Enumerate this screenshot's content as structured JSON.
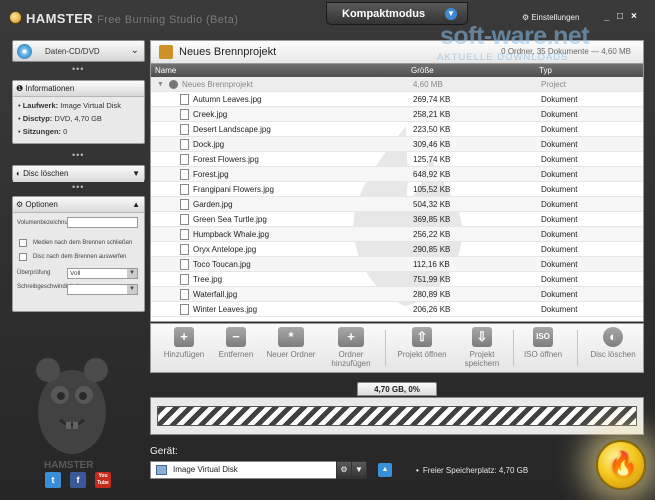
{
  "app": {
    "title": "HAMSTER",
    "subtitle": "Free Burning Studio (Beta)",
    "mode_label": "Kompaktmodus",
    "settings_label": "Einstellungen",
    "window_controls": [
      "_",
      "□",
      "×"
    ]
  },
  "sidebar": {
    "disc_type": "Daten-CD/DVD",
    "info": {
      "title": "Informationen",
      "drive_label": "Laufwerk:",
      "drive_value": "Image Virtual Disk",
      "disctype_label": "Disctyp:",
      "disctype_value": "DVD, 4,70 GB",
      "sessions_label": "Sitzungen:",
      "sessions_value": "0"
    },
    "erase_label": "Disc löschen",
    "options": {
      "title": "Optionen",
      "volume_label": "Volumenbezeichnung",
      "volume_value": "",
      "check_close_label": "Medien nach dem Brennen schließen",
      "check_eject_label": "Disc nach dem Brennen auswerfen",
      "verify_label": "Überprüfung",
      "verify_value": "Voll",
      "speed_label": "Schreibgeschwindigkeit",
      "speed_value": ""
    },
    "mascot_label": "HAMSTER",
    "social": [
      "t",
      "f",
      "You Tube"
    ]
  },
  "project": {
    "title": "Neues Brennprojekt",
    "summary": "0 Ordner, 35 Dokumente — 4,60 MB",
    "watermark": "soft-ware.net",
    "watermark_sub": "AKTUELLE DOWNLOADS"
  },
  "table": {
    "headers": [
      "Name",
      "Größe",
      "Typ"
    ],
    "root": {
      "name": "Neues Brennprojekt",
      "size": "4,60 MB",
      "type": "Project"
    },
    "rows": [
      {
        "name": "Autumn Leaves.jpg",
        "size": "269,74 KB",
        "type": "Dokument"
      },
      {
        "name": "Creek.jpg",
        "size": "258,21 KB",
        "type": "Dokument"
      },
      {
        "name": "Desert Landscape.jpg",
        "size": "223,50 KB",
        "type": "Dokument"
      },
      {
        "name": "Dock.jpg",
        "size": "309,46 KB",
        "type": "Dokument"
      },
      {
        "name": "Forest Flowers.jpg",
        "size": "125,74 KB",
        "type": "Dokument"
      },
      {
        "name": "Forest.jpg",
        "size": "648,92 KB",
        "type": "Dokument"
      },
      {
        "name": "Frangipani Flowers.jpg",
        "size": "105,52 KB",
        "type": "Dokument"
      },
      {
        "name": "Garden.jpg",
        "size": "504,32 KB",
        "type": "Dokument"
      },
      {
        "name": "Green Sea Turtle.jpg",
        "size": "369,85 KB",
        "type": "Dokument"
      },
      {
        "name": "Humpback Whale.jpg",
        "size": "256,22 KB",
        "type": "Dokument"
      },
      {
        "name": "Oryx Antelope.jpg",
        "size": "290,85 KB",
        "type": "Dokument"
      },
      {
        "name": "Toco Toucan.jpg",
        "size": "112,16 KB",
        "type": "Dokument"
      },
      {
        "name": "Tree.jpg",
        "size": "751,99 KB",
        "type": "Dokument"
      },
      {
        "name": "Waterfall.jpg",
        "size": "280,89 KB",
        "type": "Dokument"
      },
      {
        "name": "Winter Leaves.jpg",
        "size": "206,26 KB",
        "type": "Dokument"
      }
    ]
  },
  "toolbar": {
    "add": "Hinzufügen",
    "remove": "Entfernen",
    "new_folder": "Neuer Ordner",
    "add_folder_1": "Ordner",
    "add_folder_2": "hinzufügen",
    "open_project": "Projekt öffnen",
    "save_project_1": "Projekt",
    "save_project_2": "speichern",
    "open_iso": "ISO öffnen",
    "erase_disc": "Disc löschen"
  },
  "progress": {
    "label": "4,70 GB, 0%",
    "fraction": 0
  },
  "device": {
    "label": "Gerät:",
    "value": "Image Virtual Disk",
    "free_space": "Freier Speicherplatz: 4,70 GB"
  },
  "colors": {
    "accent": "#3a8fd9",
    "burn": "#f5c81e"
  }
}
